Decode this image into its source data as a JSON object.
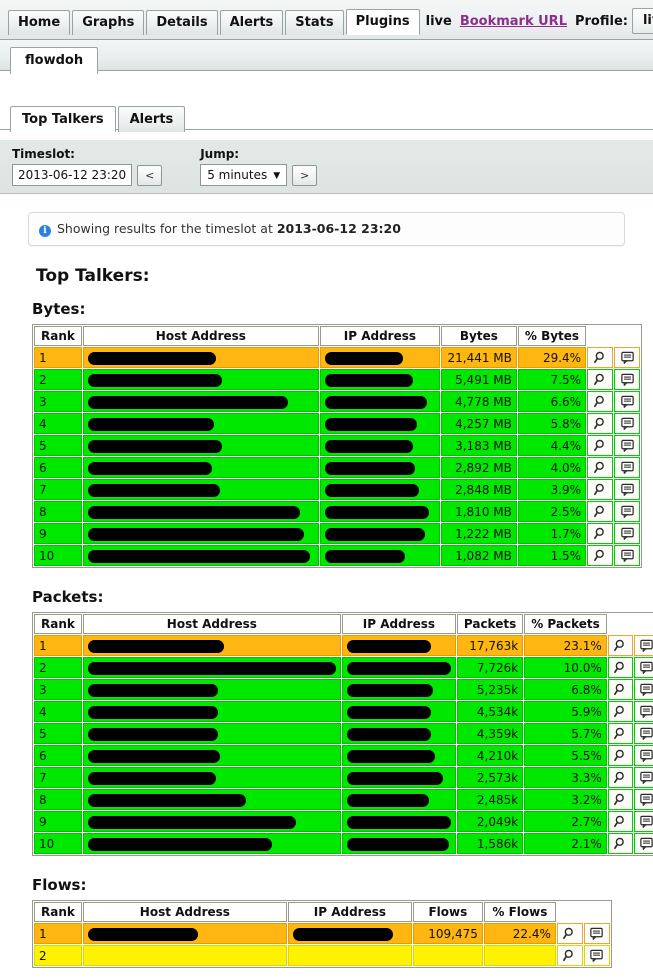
{
  "nav": {
    "tabs": [
      {
        "label": "Home",
        "active": false
      },
      {
        "label": "Graphs",
        "active": false
      },
      {
        "label": "Details",
        "active": false
      },
      {
        "label": "Alerts",
        "active": false
      },
      {
        "label": "Stats",
        "active": false
      },
      {
        "label": "Plugins",
        "active": true
      }
    ],
    "live_label": "live",
    "bookmark_label": "Bookmark URL",
    "profile_label": "Profile:",
    "profile_value": "live",
    "caret": "▼"
  },
  "plugin_tab": {
    "label": "flowdoh"
  },
  "subtabs": [
    {
      "label": "Top Talkers",
      "active": true
    },
    {
      "label": "Alerts",
      "active": false
    }
  ],
  "controls": {
    "timeslot_label": "Timeslot:",
    "timeslot_value": "2013-06-12 23:20",
    "prev_label": "<",
    "next_label": ">",
    "jump_label": "Jump:",
    "jump_value": "5 minutes",
    "jump_caret": "▼"
  },
  "alert": {
    "icon": "info-icon",
    "text_prefix": "Showing results for the timeslot at ",
    "timeslot": "2013-06-12 23:20"
  },
  "headings": {
    "page_title": "Top Talkers:",
    "bytes": "Bytes:",
    "packets": "Packets:",
    "flows": "Flows:"
  },
  "icons": {
    "search": "magnifier-icon",
    "comment": "speech-bubble-icon"
  },
  "colors": {
    "rank1": "#FFB612",
    "rows": "#00E800",
    "yellow_row": "#FFF200",
    "link": "#8b2f8b",
    "info": "#2f7fe0"
  },
  "chart_data": {
    "type": "table",
    "title": "Top Talkers",
    "tables": [
      {
        "name": "Bytes",
        "columns": [
          "Rank",
          "Host Address",
          "IP Address",
          "Bytes",
          "% Bytes"
        ],
        "rows": [
          {
            "rank": "1",
            "host_redact_w": 128,
            "ip_redact_w": 78,
            "value": "21,441 MB",
            "pct": "29.4%",
            "color": "orange"
          },
          {
            "rank": "2",
            "host_redact_w": 134,
            "ip_redact_w": 88,
            "value": "5,491 MB",
            "pct": "7.5%",
            "color": "green"
          },
          {
            "rank": "3",
            "host_redact_w": 200,
            "ip_redact_w": 102,
            "value": "4,778 MB",
            "pct": "6.6%",
            "color": "green"
          },
          {
            "rank": "4",
            "host_redact_w": 126,
            "ip_redact_w": 92,
            "value": "4,257 MB",
            "pct": "5.8%",
            "color": "green"
          },
          {
            "rank": "5",
            "host_redact_w": 134,
            "ip_redact_w": 88,
            "value": "3,183 MB",
            "pct": "4.4%",
            "color": "green"
          },
          {
            "rank": "6",
            "host_redact_w": 124,
            "ip_redact_w": 90,
            "value": "2,892 MB",
            "pct": "4.0%",
            "color": "green"
          },
          {
            "rank": "7",
            "host_redact_w": 132,
            "ip_redact_w": 94,
            "value": "2,848 MB",
            "pct": "3.9%",
            "color": "green"
          },
          {
            "rank": "8",
            "host_redact_w": 212,
            "ip_redact_w": 104,
            "value": "1,810 MB",
            "pct": "2.5%",
            "color": "green"
          },
          {
            "rank": "9",
            "host_redact_w": 216,
            "ip_redact_w": 100,
            "value": "1,222 MB",
            "pct": "1.7%",
            "color": "green"
          },
          {
            "rank": "10",
            "host_redact_w": 224,
            "ip_redact_w": 80,
            "value": "1,082 MB",
            "pct": "1.5%",
            "color": "green"
          }
        ]
      },
      {
        "name": "Packets",
        "columns": [
          "Rank",
          "Host Address",
          "IP Address",
          "Packets",
          "% Packets"
        ],
        "rows": [
          {
            "rank": "1",
            "host_redact_w": 136,
            "ip_redact_w": 84,
            "value": "17,763k",
            "pct": "23.1%",
            "color": "orange"
          },
          {
            "rank": "2",
            "host_redact_w": 248,
            "ip_redact_w": 104,
            "value": "7,726k",
            "pct": "10.0%",
            "color": "green"
          },
          {
            "rank": "3",
            "host_redact_w": 130,
            "ip_redact_w": 86,
            "value": "5,235k",
            "pct": "6.8%",
            "color": "green"
          },
          {
            "rank": "4",
            "host_redact_w": 130,
            "ip_redact_w": 84,
            "value": "4,534k",
            "pct": "5.9%",
            "color": "green"
          },
          {
            "rank": "5",
            "host_redact_w": 130,
            "ip_redact_w": 84,
            "value": "4,359k",
            "pct": "5.7%",
            "color": "green"
          },
          {
            "rank": "6",
            "host_redact_w": 132,
            "ip_redact_w": 88,
            "value": "4,210k",
            "pct": "5.5%",
            "color": "green"
          },
          {
            "rank": "7",
            "host_redact_w": 128,
            "ip_redact_w": 96,
            "value": "2,573k",
            "pct": "3.3%",
            "color": "green"
          },
          {
            "rank": "8",
            "host_redact_w": 158,
            "ip_redact_w": 82,
            "value": "2,485k",
            "pct": "3.2%",
            "color": "green"
          },
          {
            "rank": "9",
            "host_redact_w": 208,
            "ip_redact_w": 104,
            "value": "2,049k",
            "pct": "2.7%",
            "color": "green"
          },
          {
            "rank": "10",
            "host_redact_w": 184,
            "ip_redact_w": 102,
            "value": "1,586k",
            "pct": "2.1%",
            "color": "green"
          }
        ]
      },
      {
        "name": "Flows",
        "columns": [
          "Rank",
          "Host Address",
          "IP Address",
          "Flows",
          "% Flows"
        ],
        "rows": [
          {
            "rank": "1",
            "host_redact_w": 110,
            "ip_redact_w": 100,
            "value": "109,475",
            "pct": "22.4%",
            "color": "orange"
          },
          {
            "rank": "2",
            "host_redact_w": 0,
            "ip_redact_w": 0,
            "value": "",
            "pct": "",
            "color": "yellow"
          }
        ]
      }
    ]
  }
}
